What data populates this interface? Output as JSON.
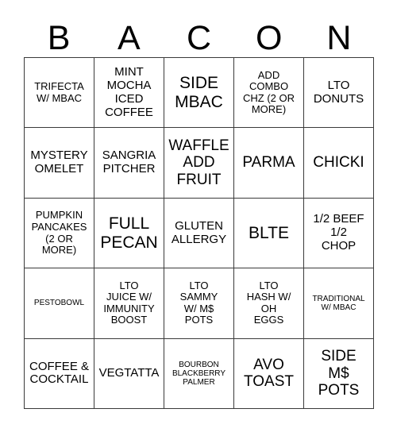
{
  "card": {
    "title_letters": [
      "B",
      "A",
      "C",
      "O",
      "N"
    ],
    "columns": 5,
    "rows": 5,
    "border_color": "#3a3a3a",
    "background_color": "#ffffff",
    "text_color": "#000000",
    "cells": [
      [
        {
          "text": "TRIFECTA\nW/ MBAC",
          "size": "sm"
        },
        {
          "text": "MINT\nMOCHA\nICED\nCOFFEE",
          "size": "md"
        },
        {
          "text": "SIDE\nMBAC",
          "size": "xl"
        },
        {
          "text": "ADD\nCOMBO\nCHZ (2 OR\nMORE)",
          "size": "sm"
        },
        {
          "text": "LTO\nDONUTS",
          "size": "md"
        }
      ],
      [
        {
          "text": "MYSTERY\nOMELET",
          "size": "md"
        },
        {
          "text": "SANGRIA\nPITCHER",
          "size": "md"
        },
        {
          "text": "WAFFLE\nADD\nFRUIT",
          "size": "lg"
        },
        {
          "text": "PARMA",
          "size": "lg"
        },
        {
          "text": "CHICKI",
          "size": "lg"
        }
      ],
      [
        {
          "text": "PUMPKIN\nPANCAKES\n(2 OR\nMORE)",
          "size": "sm"
        },
        {
          "text": "FULL\nPECAN",
          "size": "xl"
        },
        {
          "text": "GLUTEN\nALLERGY",
          "size": "md"
        },
        {
          "text": "BLTE",
          "size": "xl"
        },
        {
          "text": "1/2 BEEF\n1/2\nCHOP",
          "size": "md"
        }
      ],
      [
        {
          "text": "PESTOBOWL",
          "size": "xs"
        },
        {
          "text": "LTO\nJUICE W/\nIMMUNITY\nBOOST",
          "size": "sm"
        },
        {
          "text": "LTO\nSAMMY\nW/ M$\nPOTS",
          "size": "sm"
        },
        {
          "text": "LTO\nHASH W/\nOH\nEGGS",
          "size": "sm"
        },
        {
          "text": "TRADITIONAL\nW/ MBAC",
          "size": "xs"
        }
      ],
      [
        {
          "text": "COFFEE &\nCOCKTAIL",
          "size": "md"
        },
        {
          "text": "VEGTATTA",
          "size": "md"
        },
        {
          "text": "BOURBON\nBLACKBERRY\nPALMER",
          "size": "xs"
        },
        {
          "text": "AVO\nTOAST",
          "size": "lg"
        },
        {
          "text": "SIDE\nM$\nPOTS",
          "size": "lg"
        }
      ]
    ]
  }
}
